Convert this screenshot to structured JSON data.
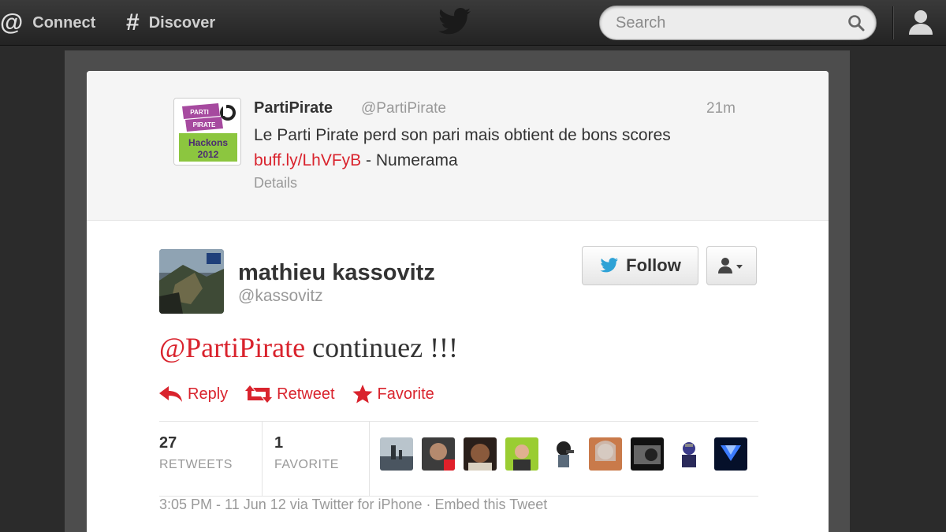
{
  "topbar": {
    "connect_label": "Connect",
    "connect_glyph": "@",
    "discover_label": "Discover",
    "discover_glyph": "#",
    "search_placeholder": "Search"
  },
  "original_tweet": {
    "name": "PartiPirate",
    "handle": "@PartiPirate",
    "time": "21m",
    "text_before": "Le Parti Pirate perd son pari mais obtient de bons scores ",
    "link": "buff.ly/LhVFyB",
    "text_after": " - Numerama",
    "details_label": "Details",
    "avatar_lines": [
      "PARTI",
      "PIRATE",
      "Hackons",
      "2012"
    ]
  },
  "tweet": {
    "name": "mathieu kassovitz",
    "handle": "@kassovitz",
    "follow_label": "Follow",
    "mention": "@PartiPirate",
    "text": " continuez !!!",
    "actions": {
      "reply": "Reply",
      "retweet": "Retweet",
      "favorite": "Favorite"
    },
    "stats": {
      "retweets_count": "27",
      "retweets_label": "RETWEETS",
      "favorites_count": "1",
      "favorites_label": "FAVORITE"
    },
    "meta": {
      "timestamp": "3:05 PM - 11 Jun 12",
      "via_prefix": " via ",
      "client": "Twitter for iPhone",
      "separator": " · ",
      "embed": "Embed this Tweet"
    }
  },
  "colors": {
    "accent": "#d9232d",
    "twitter_blue": "#2ea2d6",
    "topbar": "#2b2b2b"
  }
}
